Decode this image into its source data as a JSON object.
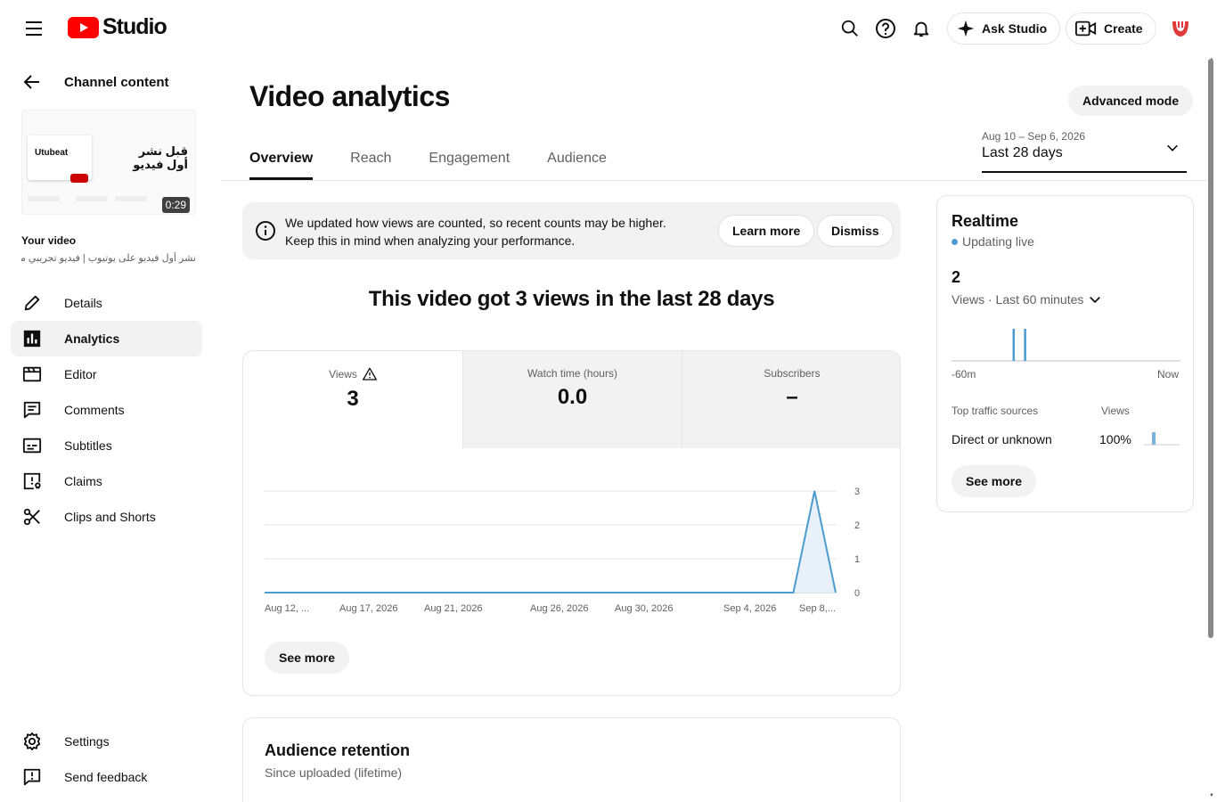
{
  "app": {
    "logo_text": "Studio",
    "ask_studio_label": "Ask Studio",
    "create_label": "Create"
  },
  "sidebar": {
    "back_label": "Channel content",
    "thumbnail": {
      "brand": "Utubeat",
      "title_line1": "قبل نشر",
      "title_line2": "أول فيديو",
      "duration": "0:29"
    },
    "your_video_label": "Your video",
    "video_title": "نشر أول فيديو على يوتيوب | فيديو تجريبي من ...",
    "items": [
      {
        "label": "Details",
        "icon": "pencil-icon"
      },
      {
        "label": "Analytics",
        "icon": "analytics-icon",
        "active": true
      },
      {
        "label": "Editor",
        "icon": "editor-icon"
      },
      {
        "label": "Comments",
        "icon": "comments-icon"
      },
      {
        "label": "Subtitles",
        "icon": "subtitles-icon"
      },
      {
        "label": "Claims",
        "icon": "claims-icon"
      },
      {
        "label": "Clips and Shorts",
        "icon": "scissors-icon"
      }
    ],
    "settings_label": "Settings",
    "feedback_label": "Send feedback"
  },
  "main": {
    "title": "Video analytics",
    "advanced_mode_label": "Advanced mode",
    "tabs": [
      {
        "label": "Overview",
        "active": true
      },
      {
        "label": "Reach"
      },
      {
        "label": "Engagement"
      },
      {
        "label": "Audience"
      }
    ],
    "date_range": {
      "dates": "Aug 10 – Sep 6, 2026",
      "period": "Last 28 days"
    },
    "notice": {
      "line1": "We updated how views are counted, so recent counts may be higher.",
      "line2": "Keep this in mind when analyzing your performance.",
      "learn_more": "Learn more",
      "dismiss": "Dismiss"
    },
    "headline": "This video got 3 views in the last 28 days",
    "metrics": [
      {
        "label": "Views",
        "value": "3",
        "warning": true
      },
      {
        "label": "Watch time (hours)",
        "value": "0.0"
      },
      {
        "label": "Subscribers",
        "value": "–"
      }
    ],
    "see_more_label": "See more",
    "retention": {
      "title": "Audience retention",
      "subtitle": "Since uploaded (lifetime)"
    }
  },
  "realtime": {
    "title": "Realtime",
    "status": "Updating live",
    "count": "2",
    "metric_label": "Views · Last 60 minutes",
    "axis_start": "-60m",
    "axis_end": "Now",
    "table_header_source": "Top traffic sources",
    "table_header_views": "Views",
    "source": "Direct or unknown",
    "source_pct": "100%",
    "see_more_label": "See more",
    "bars": [
      {
        "minute": -44,
        "views": 1
      },
      {
        "minute": -41,
        "views": 1
      }
    ]
  },
  "chart_data": {
    "type": "area",
    "x": [
      "Aug 10, 2026",
      "Aug 11, 2026",
      "Aug 12, 2026",
      "Aug 13, 2026",
      "Aug 14, 2026",
      "Aug 15, 2026",
      "Aug 16, 2026",
      "Aug 17, 2026",
      "Aug 18, 2026",
      "Aug 19, 2026",
      "Aug 20, 2026",
      "Aug 21, 2026",
      "Aug 22, 2026",
      "Aug 23, 2026",
      "Aug 24, 2026",
      "Aug 25, 2026",
      "Aug 26, 2026",
      "Aug 27, 2026",
      "Aug 28, 2026",
      "Aug 29, 2026",
      "Aug 30, 2026",
      "Aug 31, 2026",
      "Sep 1, 2026",
      "Sep 2, 2026",
      "Sep 3, 2026",
      "Sep 4, 2026",
      "Sep 5, 2026",
      "Sep 6, 2026"
    ],
    "tick_labels": [
      "Aug 12, ...",
      "Aug 17, 2026",
      "Aug 21, 2026",
      "Aug 26, 2026",
      "Aug 30, 2026",
      "Sep 4, 2026",
      "Sep 8,..."
    ],
    "series": [
      {
        "values": [
          0,
          0,
          0,
          0,
          0,
          0,
          0,
          0,
          0,
          0,
          0,
          0,
          0,
          0,
          0,
          0,
          0,
          0,
          0,
          0,
          0,
          0,
          0,
          0,
          0,
          0,
          3,
          0
        ]
      }
    ],
    "yticks": [
      0,
      1,
      2,
      3
    ],
    "ylim": [
      0,
      3
    ],
    "grid": true,
    "color": "#4c9bd1",
    "fill": "#e8f1fa"
  }
}
